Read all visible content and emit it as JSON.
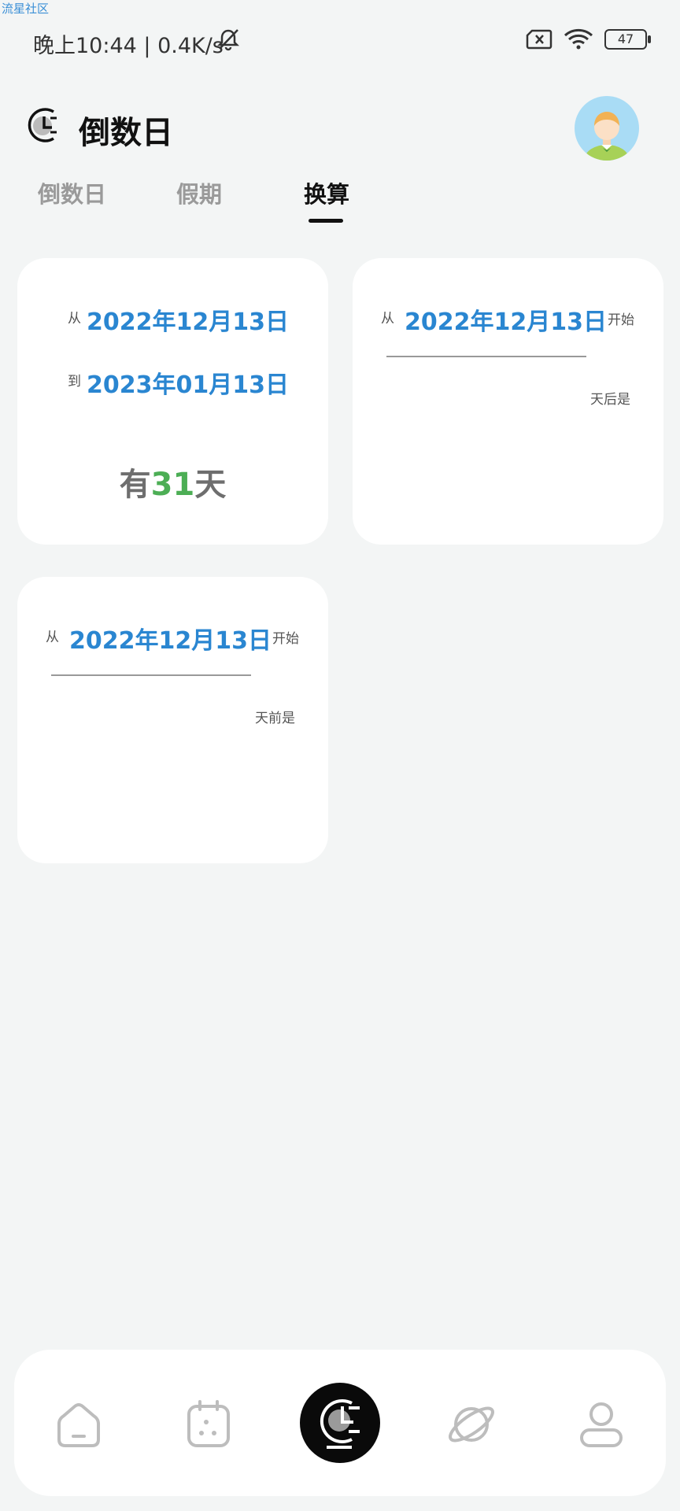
{
  "watermark": "流星社区",
  "status_bar": {
    "time": "晚上10:44 | 0.4K/s",
    "battery": "47",
    "icons": [
      "bell-off-icon",
      "sim-error-icon",
      "wifi-icon",
      "battery-icon"
    ]
  },
  "header": {
    "title": "倒数日",
    "logo_icon": "clock-icon",
    "avatar_icon": "avatar"
  },
  "tabs": [
    {
      "label": "倒数日",
      "active": false
    },
    {
      "label": "假期",
      "active": false
    },
    {
      "label": "换算",
      "active": true
    }
  ],
  "cards": {
    "between": {
      "from_label": "从",
      "from_date": "2022年12月13日",
      "to_label": "到",
      "to_date": "2023年01月13日",
      "result_prefix": "有",
      "days": "31",
      "result_suffix": "天"
    },
    "after": {
      "from_label": "从",
      "date": "2022年12月13日",
      "start_label": "开始",
      "suffix": "天后是",
      "input_value": ""
    },
    "before": {
      "from_label": "从",
      "date": "2022年12月13日",
      "start_label": "开始",
      "suffix": "天前是",
      "input_value": ""
    }
  },
  "bottom_nav": {
    "items": [
      "home-icon",
      "calendar-icon",
      "countdown-icon",
      "planet-icon",
      "profile-icon"
    ],
    "active": "countdown-icon"
  },
  "colors": {
    "accent_blue": "#2a86d1",
    "result_green": "#4cae55",
    "background": "#f3f5f5"
  }
}
